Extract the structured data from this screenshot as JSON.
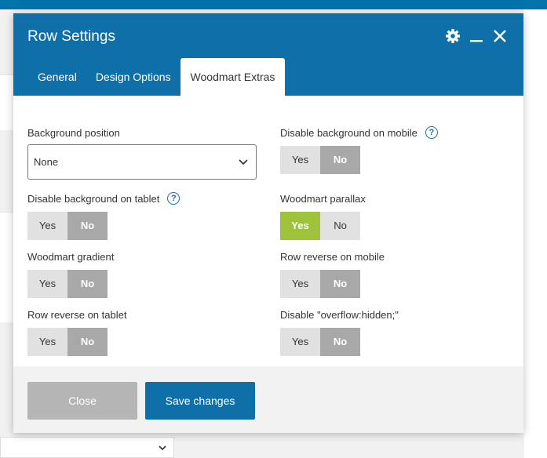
{
  "modal": {
    "title": "Row Settings",
    "tabs": [
      {
        "label": "General"
      },
      {
        "label": "Design Options"
      },
      {
        "label": "Woodmart Extras"
      }
    ],
    "fields": {
      "background_position": {
        "label": "Background position",
        "value": "None"
      },
      "disable_bg_mobile": {
        "label": "Disable background on mobile",
        "yes": "Yes",
        "no": "No",
        "selected": "No"
      },
      "disable_bg_tablet": {
        "label": "Disable background on tablet",
        "yes": "Yes",
        "no": "No",
        "selected": "No"
      },
      "woodmart_parallax": {
        "label": "Woodmart parallax",
        "yes": "Yes",
        "no": "No",
        "selected": "Yes"
      },
      "woodmart_gradient": {
        "label": "Woodmart gradient",
        "yes": "Yes",
        "no": "No",
        "selected": "No"
      },
      "row_reverse_mobile": {
        "label": "Row reverse on mobile",
        "yes": "Yes",
        "no": "No",
        "selected": "No"
      },
      "row_reverse_tablet": {
        "label": "Row reverse on tablet",
        "yes": "Yes",
        "no": "No",
        "selected": "No"
      },
      "disable_overflow": {
        "label": "Disable \"overflow:hidden;\"",
        "yes": "Yes",
        "no": "No",
        "selected": "No"
      }
    },
    "help_glyph": "?",
    "footer": {
      "close_label": "Close",
      "save_label": "Save changes"
    }
  },
  "colors": {
    "header": "#0f6fa8",
    "active_yes": "#9ec33a",
    "active_no": "#a8a8a8"
  }
}
